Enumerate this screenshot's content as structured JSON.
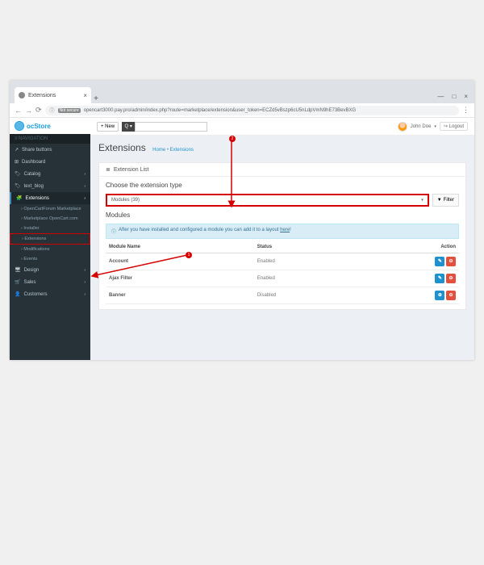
{
  "browser": {
    "tab_title": "Extensions",
    "url_prefix": "Not secure",
    "url": "opencart3000.pay.pro/admin/index.php?route=marketplace/extension&user_token=ECZd5vBszp6cU5nLdpVmN9hE73BevBXG"
  },
  "logo_text": "ocStore",
  "nav": {
    "header": "NAVIGATION",
    "items": [
      {
        "label": "Share buttons",
        "icon": "↗"
      },
      {
        "label": "Dashboard",
        "icon": "⊞"
      },
      {
        "label": "Catalog",
        "icon": "🏷"
      },
      {
        "label": "text_blog",
        "icon": "🏷"
      },
      {
        "label": "Extensions",
        "icon": "🧩",
        "active": true
      },
      {
        "label": "Design",
        "icon": "🖥"
      },
      {
        "label": "Sales",
        "icon": "🛒"
      },
      {
        "label": "Customers",
        "icon": "👤"
      }
    ],
    "sub": [
      "OpenCartForum Marketplace",
      "Marketplace OpenCart.com",
      "Installer",
      "Extensions",
      "Modifications",
      "Events"
    ]
  },
  "topbar": {
    "new_label": "+ New",
    "search_placeholder": "",
    "user_name": "John Doe",
    "logout": "Logout"
  },
  "page": {
    "title": "Extensions",
    "crumb_home": "Home",
    "crumb_cur": "Extensions"
  },
  "panel": {
    "list_title": "Extension List",
    "choose_label": "Choose the extension type",
    "select_value": "Modules (39)",
    "filter_label": "Filter"
  },
  "modules": {
    "heading": "Modules",
    "info_text": "After you have installed and configured a module you can add it to a layout ",
    "info_link": "here",
    "col_name": "Module Name",
    "col_status": "Status",
    "col_action": "Action",
    "rows": [
      {
        "name": "Account",
        "status": "Enabled",
        "style": "edit"
      },
      {
        "name": "Ajax Filter",
        "status": "Enabled",
        "style": "edit"
      },
      {
        "name": "Banner",
        "status": "Disabled",
        "style": "add"
      }
    ]
  },
  "annotations": {
    "step1": "1",
    "step2": "2"
  }
}
